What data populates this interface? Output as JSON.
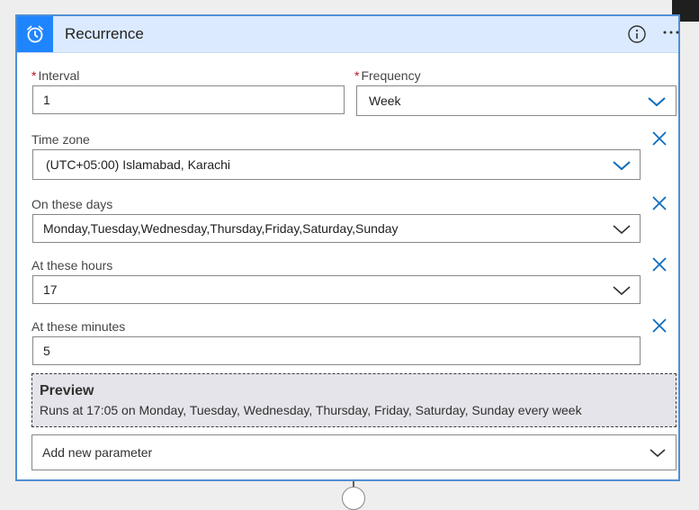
{
  "card": {
    "title": "Recurrence",
    "trigger_icon": "alarm-clock-icon",
    "accent_color": "#1f85ff",
    "header_bg": "#dbeafe"
  },
  "fields": {
    "interval": {
      "label": "Interval",
      "required": "*",
      "value": "1"
    },
    "frequency": {
      "label": "Frequency",
      "required": "*",
      "value": "Week"
    },
    "time_zone": {
      "label": "Time zone",
      "value": "(UTC+05:00) Islamabad, Karachi"
    },
    "on_these_days": {
      "label": "On these days",
      "value": "Monday,Tuesday,Wednesday,Thursday,Friday,Saturday,Sunday"
    },
    "at_these_hours": {
      "label": "At these hours",
      "value": "17"
    },
    "at_these_minutes": {
      "label": "At these minutes",
      "value": "5"
    }
  },
  "preview": {
    "title": "Preview",
    "text": "Runs at 17:05 on Monday, Tuesday, Wednesday, Thursday, Friday, Saturday, Sunday every week"
  },
  "add_parameter": {
    "label": "Add new parameter"
  }
}
